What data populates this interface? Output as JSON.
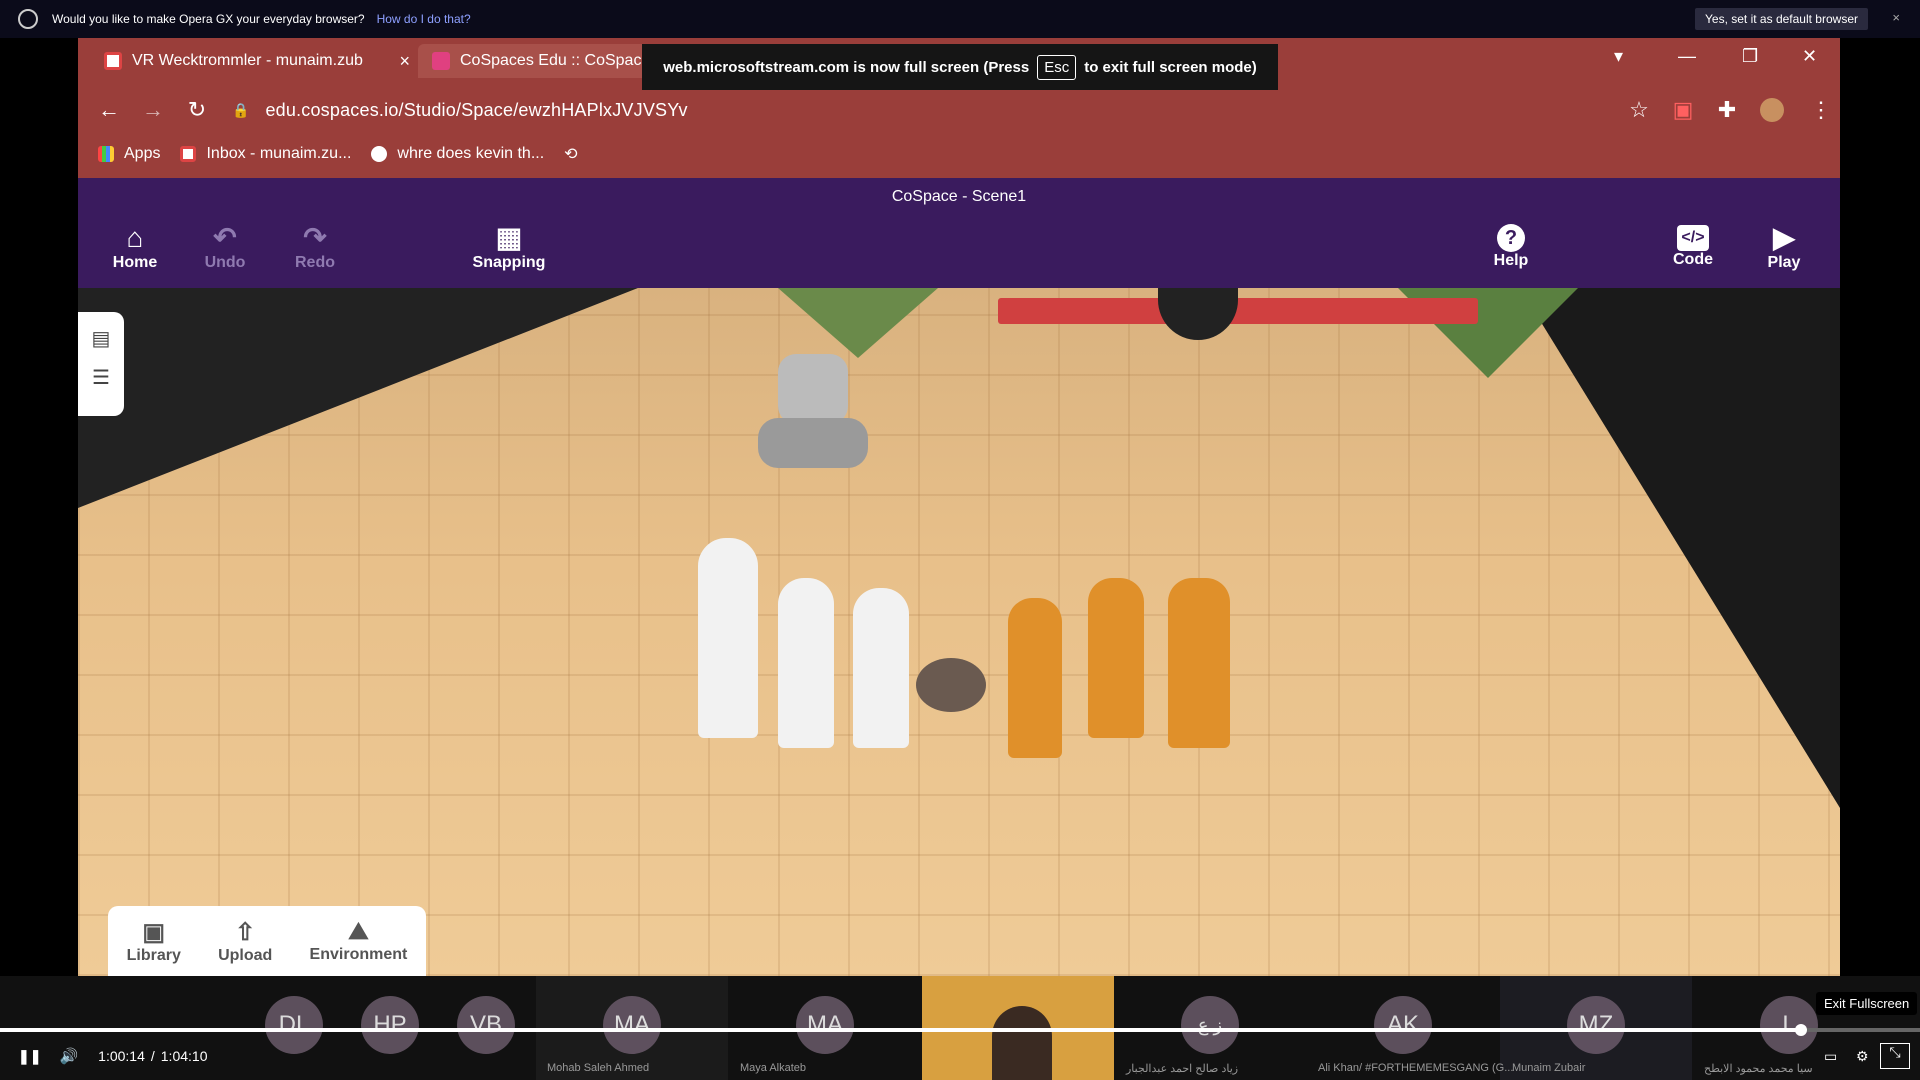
{
  "opera_banner": {
    "question": "Would you like to make Opera GX your everyday browser?",
    "how_link": "How do I do that?",
    "yes_button": "Yes, set it as default browser",
    "close": "×"
  },
  "browser": {
    "tabs": [
      {
        "title": "VR Wecktrommler - munaim.zub",
        "close": "×"
      },
      {
        "title": "CoSpaces Edu :: CoSpac"
      }
    ],
    "fullscreen_notice": {
      "before": "web.microsoftstream.com is now full screen (Press",
      "key": "Esc",
      "after": "to exit full screen mode)"
    },
    "url": "edu.cospaces.io/Studio/Space/ewzhHAPlxJVJVSYv",
    "bookmarks": [
      "Apps",
      "Inbox - munaim.zu...",
      "whre does kevin th..."
    ]
  },
  "cospaces": {
    "scene_title": "CoSpace - Scene1",
    "tools_left": [
      {
        "label": "Home",
        "icon": "⌂"
      },
      {
        "label": "Undo",
        "icon": "↶"
      },
      {
        "label": "Redo",
        "icon": "↷"
      },
      {
        "label": "Snapping",
        "icon": "▦"
      }
    ],
    "tools_right": [
      {
        "label": "Help",
        "icon": "?"
      },
      {
        "label": "Code",
        "icon": "</>"
      },
      {
        "label": "Play",
        "icon": "▶"
      }
    ],
    "bottom_panel": [
      {
        "label": "Library",
        "icon": "▣"
      },
      {
        "label": "Upload",
        "icon": "⇧"
      },
      {
        "label": "Environment",
        "icon": "⛰"
      }
    ]
  },
  "participants": [
    {
      "initials": "DL",
      "name": ""
    },
    {
      "initials": "HP",
      "name": ""
    },
    {
      "initials": "VB",
      "name": ""
    },
    {
      "initials": "MA",
      "name": "Mohab   Saleh Ahmed"
    },
    {
      "initials": "MA",
      "name": "Maya Alkateb"
    },
    {
      "initials": "ز ع",
      "name": "زياد صالح احمد عبدالجبار"
    },
    {
      "initials": "AK",
      "name": "Ali Khan/ #FORTHEMEMESGANG (G..."
    },
    {
      "initials": "MZ",
      "name": "Munaim Zubair"
    },
    {
      "initials": "L",
      "name": "سيا محمد محمود الابطح"
    }
  ],
  "player": {
    "time_current": "1:00:14",
    "time_separator": "/",
    "time_total": "1:04:10",
    "progress_fraction": 0.938,
    "tooltip": "Exit Fullscreen"
  }
}
